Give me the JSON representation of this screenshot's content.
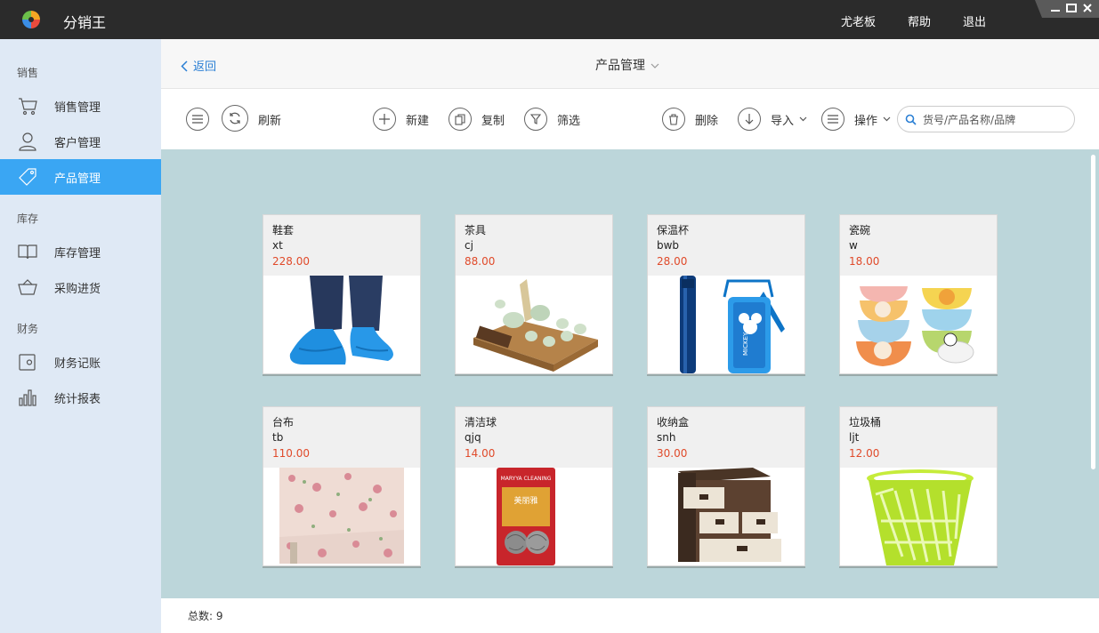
{
  "app": {
    "name": "分销王"
  },
  "topbar": {
    "user": "尤老板",
    "help": "帮助",
    "logout": "退出"
  },
  "sidebar": {
    "sections": [
      {
        "title": "销售",
        "items": [
          {
            "label": "销售管理",
            "icon": "cart-icon"
          },
          {
            "label": "客户管理",
            "icon": "user-icon"
          },
          {
            "label": "产品管理",
            "icon": "tag-icon",
            "active": true
          }
        ]
      },
      {
        "title": "库存",
        "items": [
          {
            "label": "库存管理",
            "icon": "book-icon"
          },
          {
            "label": "采购进货",
            "icon": "basket-icon"
          }
        ]
      },
      {
        "title": "财务",
        "items": [
          {
            "label": "财务记账",
            "icon": "wallet-icon"
          },
          {
            "label": "统计报表",
            "icon": "bar-chart-icon"
          }
        ]
      }
    ]
  },
  "header": {
    "back": "返回",
    "title": "产品管理"
  },
  "toolbar": {
    "refresh": "刷新",
    "new": "新建",
    "copy": "复制",
    "filter": "筛选",
    "delete": "删除",
    "import": "导入",
    "actions": "操作",
    "search_placeholder": "货号/产品名称/品牌"
  },
  "products": [
    {
      "name": "鞋套",
      "code": "xt",
      "price": "228.00"
    },
    {
      "name": "茶具",
      "code": "cj",
      "price": "88.00"
    },
    {
      "name": "保温杯",
      "code": "bwb",
      "price": "28.00"
    },
    {
      "name": "瓷碗",
      "code": "w",
      "price": "18.00"
    },
    {
      "name": "台布",
      "code": "tb",
      "price": "110.00"
    },
    {
      "name": "清洁球",
      "code": "qjq",
      "price": "14.00"
    },
    {
      "name": "收纳盒",
      "code": "snh",
      "price": "30.00"
    },
    {
      "name": "垃圾桶",
      "code": "ljt",
      "price": "12.00"
    }
  ],
  "product_images": [
    {
      "brand": "",
      "label": ""
    },
    {
      "brand": "",
      "label": ""
    },
    {
      "brand": "MICKEY",
      "label": ""
    },
    {
      "brand": "",
      "label": ""
    },
    {
      "brand": "",
      "label": ""
    },
    {
      "brand": "MARYYA CLEANING",
      "label": "美丽雅"
    },
    {
      "brand": "",
      "label": ""
    },
    {
      "brand": "",
      "label": ""
    }
  ],
  "footer": {
    "total_label": "总数:",
    "total_value": "9"
  },
  "colors": {
    "accent": "#3aa6f3",
    "price": "#e04a2a",
    "content_bg": "#bcd6da",
    "titlebar": "#2b2b2b"
  }
}
